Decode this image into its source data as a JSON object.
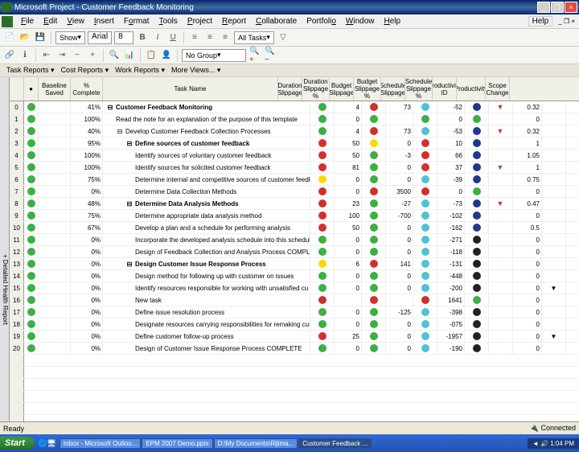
{
  "window": {
    "title": "Microsoft Project - Customer Feedback Monitoring"
  },
  "menu": {
    "file": "File",
    "edit": "Edit",
    "view": "View",
    "insert": "Insert",
    "format": "Format",
    "tools": "Tools",
    "project": "Project",
    "report": "Report",
    "collaborate": "Collaborate",
    "portfolio": "Portfolio",
    "window": "Window",
    "help": "Help",
    "typehelp": "Help",
    "closehint": "×"
  },
  "toolbar": {
    "show": "Show",
    "font": "Arial",
    "size": "8",
    "filter": "All Tasks",
    "group": "No Group"
  },
  "reports": {
    "task": "Task Reports",
    "cost": "Cost Reports",
    "work": "Work Reports",
    "more": "More Views..."
  },
  "sidebar": {
    "label": "+ Detailed Health Report"
  },
  "cols": {
    "rowid": "",
    "ind": "Baseline Saved",
    "pct": "% Complete",
    "tname": "Task Name",
    "durslip": "Duration Slippage",
    "durslippc": "Duration Slippage %",
    "budslip": "Budget Slippage",
    "budslippc": "Budget Slippage %",
    "schslip": "Schedule Slippage",
    "schslippc": "Schedule Slippage %",
    "prodid": "Productivity ID",
    "prod": "Productivity",
    "scope": "Scope Change"
  },
  "rows": [
    {
      "id": "0",
      "pct": "41%",
      "indent": 0,
      "tree": "-",
      "name": "Customer Feedback Monitoring",
      "c1": "g",
      "v1": "4",
      "c2": "r",
      "v2": "73",
      "c3": "c",
      "v3": "-52",
      "c4": "bl",
      "v4": "",
      "flag": "red",
      "prod": "0.32",
      "scope": ""
    },
    {
      "id": "1",
      "pct": "100%",
      "indent": 1,
      "tree": "",
      "name": "Read the note for an explanation of the purpose of this template",
      "c1": "g",
      "v1": "0",
      "c2": "g",
      "v2": "",
      "c3": "g",
      "v3": "0",
      "c4": "g",
      "v4": "",
      "flag": "",
      "prod": "0",
      "scope": ""
    },
    {
      "id": "2",
      "pct": "40%",
      "indent": 1,
      "tree": "-",
      "name": "Develop Customer Feedback Collection Processes",
      "c1": "g",
      "v1": "4",
      "c2": "r",
      "v2": "73",
      "c3": "c",
      "v3": "-53",
      "c4": "bl",
      "v4": "",
      "flag": "red",
      "prod": "0.32",
      "scope": ""
    },
    {
      "id": "3",
      "pct": "95%",
      "indent": 2,
      "tree": "-",
      "name": "Define sources of customer feedback",
      "c1": "r",
      "v1": "50",
      "c2": "y",
      "v2": "0",
      "c3": "r",
      "v3": "10",
      "c4": "bl",
      "v4": "",
      "flag": "",
      "prod": "1",
      "scope": ""
    },
    {
      "id": "4",
      "pct": "100%",
      "indent": 3,
      "tree": "",
      "name": "Identify sources of voluntary customer feedback",
      "c1": "r",
      "v1": "50",
      "c2": "g",
      "v2": "-3",
      "c3": "r",
      "v3": "66",
      "c4": "bl",
      "v4": "",
      "flag": "",
      "prod": "1.05",
      "scope": ""
    },
    {
      "id": "5",
      "pct": "100%",
      "indent": 3,
      "tree": "",
      "name": "Identify sources for solicited customer feedback",
      "c1": "r",
      "v1": "81",
      "c2": "g",
      "v2": "0",
      "c3": "r",
      "v3": "37",
      "c4": "bl",
      "v4": "",
      "flag": "blue",
      "prod": "1",
      "scope": ""
    },
    {
      "id": "6",
      "pct": "75%",
      "indent": 3,
      "tree": "",
      "name": "Determine internal and competitive sources of customer feedb",
      "c1": "y",
      "v1": "0",
      "c2": "g",
      "v2": "0",
      "c3": "c",
      "v3": "-39",
      "c4": "bl",
      "v4": "",
      "flag": "",
      "prod": "0.75",
      "scope": ""
    },
    {
      "id": "7",
      "pct": "0%",
      "indent": 3,
      "tree": "",
      "name": "Determine Data Collection Methods",
      "c1": "r",
      "v1": "0",
      "c2": "r",
      "v2": "3500",
      "c3": "r",
      "v3": "0",
      "c4": "g",
      "v4": "",
      "flag": "",
      "prod": "0",
      "scope": ""
    },
    {
      "id": "8",
      "pct": "48%",
      "indent": 2,
      "tree": "-",
      "name": "Determine Data Analysis Methods",
      "c1": "r",
      "v1": "23",
      "c2": "g",
      "v2": "-27",
      "c3": "c",
      "v3": "-73",
      "c4": "bl",
      "v4": "",
      "flag": "red",
      "prod": "0.47",
      "scope": ""
    },
    {
      "id": "9",
      "pct": "75%",
      "indent": 3,
      "tree": "",
      "name": "Determine appropriate data analysis method",
      "c1": "r",
      "v1": "100",
      "c2": "g",
      "v2": "-700",
      "c3": "c",
      "v3": "-102",
      "c4": "bl",
      "v4": "",
      "flag": "",
      "prod": "0",
      "scope": ""
    },
    {
      "id": "10",
      "pct": "67%",
      "indent": 3,
      "tree": "",
      "name": "Develop a plan and a schedule for performing analysis",
      "c1": "r",
      "v1": "50",
      "c2": "g",
      "v2": "0",
      "c3": "c",
      "v3": "-162",
      "c4": "bl",
      "v4": "",
      "flag": "",
      "prod": "0.5",
      "scope": ""
    },
    {
      "id": "11",
      "pct": "0%",
      "indent": 3,
      "tree": "",
      "name": "Incorporate the developed analysis schedule into this schedule",
      "c1": "g",
      "v1": "0",
      "c2": "g",
      "v2": "0",
      "c3": "c",
      "v3": "-271",
      "c4": "bk",
      "v4": "",
      "flag": "",
      "prod": "0",
      "scope": ""
    },
    {
      "id": "12",
      "pct": "0%",
      "indent": 3,
      "tree": "",
      "name": "Design of Feedback Collection and Analysis Process COMPLETE",
      "c1": "g",
      "v1": "0",
      "c2": "g",
      "v2": "0",
      "c3": "c",
      "v3": "-118",
      "c4": "bk",
      "v4": "",
      "flag": "",
      "prod": "0",
      "scope": ""
    },
    {
      "id": "13",
      "pct": "0%",
      "indent": 2,
      "tree": "-",
      "name": "Design Customer Issue Response Process",
      "c1": "y",
      "v1": "6",
      "c2": "r",
      "v2": "141",
      "c3": "c",
      "v3": "-131",
      "c4": "bk",
      "v4": "",
      "flag": "",
      "prod": "0",
      "scope": ""
    },
    {
      "id": "14",
      "pct": "0%",
      "indent": 3,
      "tree": "",
      "name": "Design method for following up with customer on issues",
      "c1": "g",
      "v1": "0",
      "c2": "g",
      "v2": "0",
      "c3": "c",
      "v3": "-448",
      "c4": "bk",
      "v4": "",
      "flag": "",
      "prod": "0",
      "scope": ""
    },
    {
      "id": "15",
      "pct": "0%",
      "indent": 3,
      "tree": "",
      "name": "Identify resources responsible for working with unsatisfied cu",
      "c1": "g",
      "v1": "0",
      "c2": "g",
      "v2": "0",
      "c3": "c",
      "v3": "-200",
      "c4": "bk",
      "v4": "",
      "flag": "",
      "prod": "0",
      "scope": "▼"
    },
    {
      "id": "16",
      "pct": "0%",
      "indent": 3,
      "tree": "",
      "name": "New task",
      "c1": "r",
      "v1": "",
      "c2": "r",
      "v2": "",
      "c3": "r",
      "v3": "1641",
      "c4": "g",
      "v4": "",
      "flag": "",
      "prod": "0",
      "scope": ""
    },
    {
      "id": "17",
      "pct": "0%",
      "indent": 3,
      "tree": "",
      "name": "Define issue resolution process",
      "c1": "g",
      "v1": "0",
      "c2": "g",
      "v2": "-125",
      "c3": "c",
      "v3": "-398",
      "c4": "bk",
      "v4": "",
      "flag": "",
      "prod": "0",
      "scope": ""
    },
    {
      "id": "18",
      "pct": "0%",
      "indent": 3,
      "tree": "",
      "name": "Designate resources carrying responsibilities for remaking custom",
      "c1": "g",
      "v1": "0",
      "c2": "g",
      "v2": "0",
      "c3": "c",
      "v3": "-075",
      "c4": "bk",
      "v4": "",
      "flag": "",
      "prod": "0",
      "scope": ""
    },
    {
      "id": "19",
      "pct": "0%",
      "indent": 3,
      "tree": "",
      "name": "Define customer follow-up process",
      "c1": "r",
      "v1": "25",
      "c2": "g",
      "v2": "0",
      "c3": "c",
      "v3": "-1957",
      "c4": "bk",
      "v4": "",
      "flag": "",
      "prod": "0",
      "scope": "▼"
    },
    {
      "id": "20",
      "pct": "0%",
      "indent": 3,
      "tree": "",
      "name": "Design of Customer Issue Response Process COMPLETE",
      "c1": "g",
      "v1": "0",
      "c2": "g",
      "v2": "0",
      "c3": "c",
      "v3": "-190",
      "c4": "bk",
      "v4": "",
      "flag": "",
      "prod": "0",
      "scope": ""
    }
  ],
  "status": {
    "ready": "Ready",
    "conn": "Connected"
  },
  "taskbar": {
    "start": "Start",
    "t1": "Inbox - Microsoft Outloo...",
    "t2": "EPM 2007 Demo.pptx",
    "t3": "D:\\My Documents\\Rijima...",
    "t4": "Customer Feedback ...",
    "time": "1:04 PM"
  }
}
